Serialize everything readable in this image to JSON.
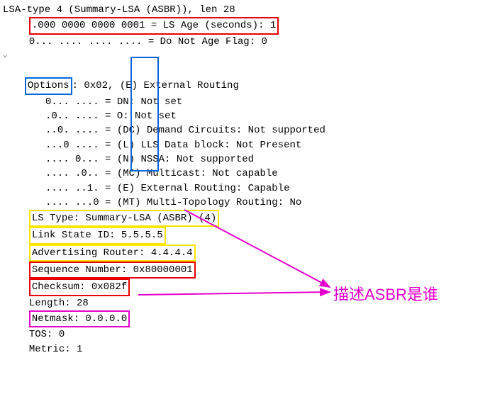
{
  "header": {
    "title": "LSA-type 4 (Summary-LSA (ASBR)), len 28"
  },
  "ls_age": {
    "bits_label": ".000 0000 0000 0001 = LS Age (seconds): 1"
  },
  "do_not_age": {
    "line": "0... .... .... .... = Do Not Age Flag: 0"
  },
  "options_header": {
    "label": "Options",
    "rest": ": 0x02, (E) External Routing"
  },
  "option_bits": [
    {
      "prefix": "0... .... = ",
      "flag": "DN:",
      "desc": " Not set"
    },
    {
      "prefix": ".0.. .... = ",
      "flag": "O: ",
      "desc": "Not set"
    },
    {
      "prefix": "..0. .... = ",
      "flag": "(DC)",
      "desc": " Demand Circuits: Not supported"
    },
    {
      "prefix": "...0 .... = ",
      "flag": "(L)",
      "desc": " LLS Data block: Not Present"
    },
    {
      "prefix": ".... 0... = ",
      "flag": "(N)",
      "desc": " NSSA: Not supported"
    },
    {
      "prefix": ".... .0.. = ",
      "flag": "(MC)",
      "desc": " Multicast: Not capable"
    },
    {
      "prefix": ".... ..1. = ",
      "flag": "(E)",
      "desc": " External Routing: Capable"
    },
    {
      "prefix": ".... ...0 = ",
      "flag": "(MT)",
      "desc": " Multi-Topology Routing: No"
    }
  ],
  "fields": {
    "ls_type": "LS Type: Summary-LSA (ASBR) (4)",
    "link_state_id": "Link State ID: 5.5.5.5",
    "adv_router": "Advertising Router: 4.4.4.4",
    "seq_num": "Sequence Number: 0x80000001",
    "checksum": "Checksum: 0x082f",
    "length": "Length: 28",
    "netmask": "Netmask: 0.0.0.0",
    "tos": "TOS: 0",
    "metric": "Metric: 1"
  },
  "annotation": {
    "text": "描述ASBR是谁"
  }
}
